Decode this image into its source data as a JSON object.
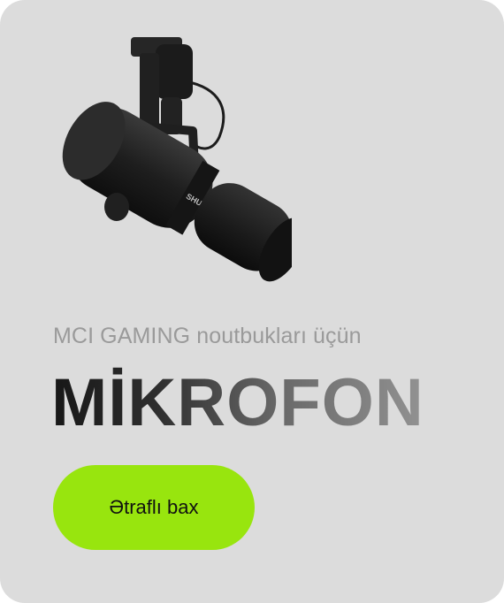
{
  "promo": {
    "subtitle": "MCI GAMING noutbukları üçün",
    "title": "MİKROFON",
    "cta_label": "Ətraflı bax",
    "brand_text": "SHURE",
    "product_icon": "microphone-icon",
    "accent_color": "#98e50e",
    "background_color": "#dcdcdc"
  }
}
